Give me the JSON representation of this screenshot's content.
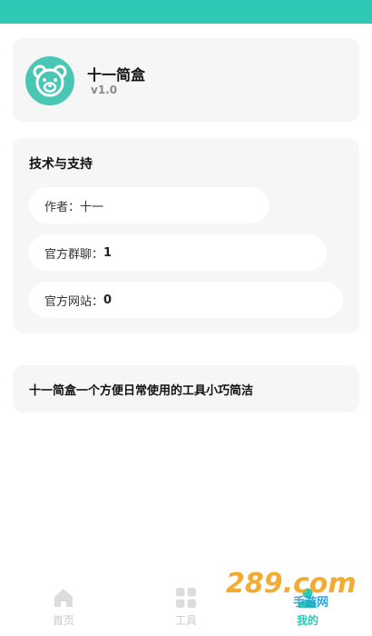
{
  "app": {
    "name": "十一简盒",
    "version": "v1.0",
    "logo_icon": "bear-face-icon"
  },
  "support": {
    "title": "技术与支持",
    "author_label": "作者：",
    "author_value": "十一",
    "group_label": "官方群聊：",
    "group_value": "1",
    "site_label": "官方网站：",
    "site_value": "0"
  },
  "description": "十一简盒一个方便日常使用的工具小巧简洁",
  "bottom_nav": {
    "items": [
      {
        "label": "首页",
        "icon": "home-icon"
      },
      {
        "label": "工具",
        "icon": "grid-icon"
      },
      {
        "label": "我的",
        "icon": "person-icon"
      }
    ]
  },
  "watermark": {
    "text": "289.com",
    "subtext": "手游网"
  },
  "colors": {
    "accent": "#2ec9b4",
    "logo_bg": "#49c7b4",
    "card_bg": "#f6f6f6",
    "inactive": "#c9c9c9"
  }
}
